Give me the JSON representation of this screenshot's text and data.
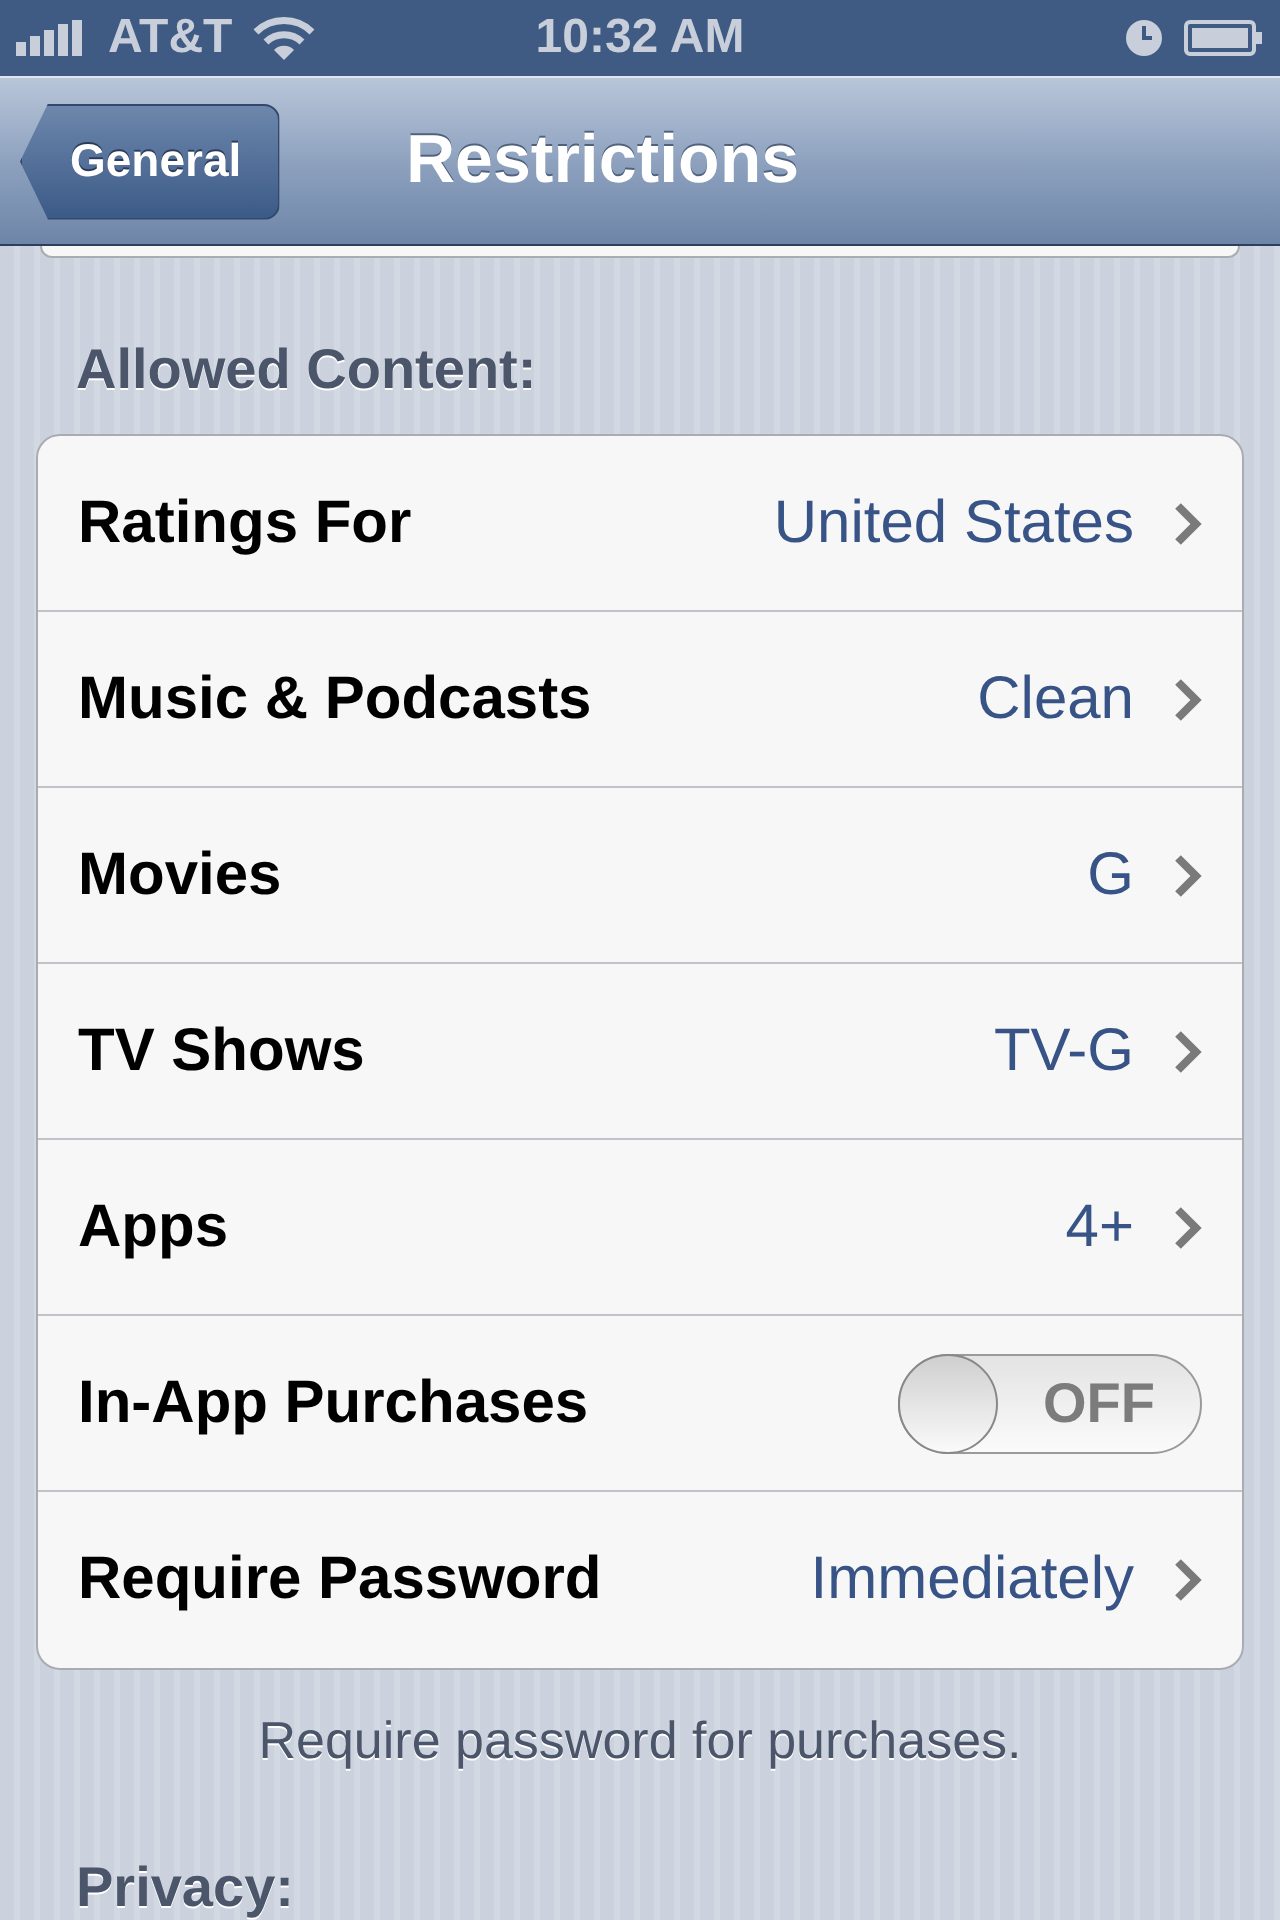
{
  "status_bar": {
    "carrier": "AT&T",
    "time": "10:32 AM"
  },
  "nav_bar": {
    "back_button": "General",
    "title": "Restrictions"
  },
  "section": {
    "header": "Allowed Content:",
    "footer": "Require password for purchases.",
    "rows": [
      {
        "kind": "value",
        "label": "Ratings For",
        "value": "United States"
      },
      {
        "kind": "value",
        "label": "Music & Podcasts",
        "value": "Clean"
      },
      {
        "kind": "value",
        "label": "Movies",
        "value": "G"
      },
      {
        "kind": "value",
        "label": "TV Shows",
        "value": "TV-G"
      },
      {
        "kind": "value",
        "label": "Apps",
        "value": "4+"
      },
      {
        "kind": "toggle",
        "label": "In-App Purchases",
        "on": false,
        "state_text": "OFF"
      },
      {
        "kind": "value",
        "label": "Require Password",
        "value": "Immediately"
      }
    ]
  },
  "next_section": {
    "header": "Privacy:"
  }
}
